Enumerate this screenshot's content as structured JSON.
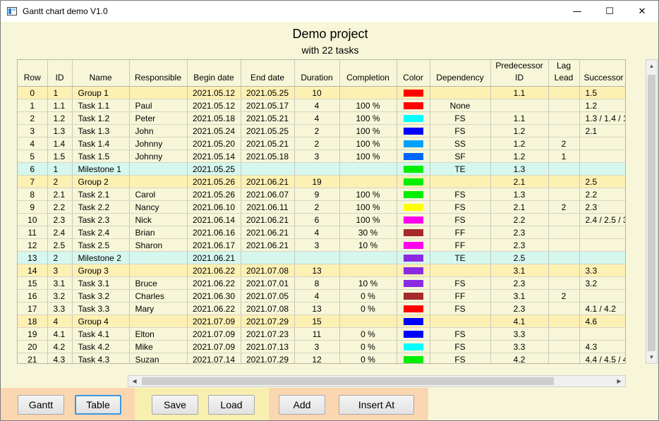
{
  "window": {
    "title": "Gantt chart demo V1.0",
    "minimize": "—",
    "maximize": "☐",
    "close": "✕"
  },
  "project": {
    "title": "Demo project",
    "subtitle": "with 22 tasks"
  },
  "columns": [
    "Row",
    "ID",
    "Name",
    "Responsible",
    "Begin date",
    "End date",
    "Duration",
    "Completion",
    "Color",
    "Dependency",
    "Predecessor ID",
    "Lag Lead",
    "Successor ID"
  ],
  "columns_wrapped": {
    "predecessor": [
      "Predecessor",
      "ID"
    ],
    "lag": [
      "Lag",
      "Lead"
    ],
    "successor": "Successor I"
  },
  "rows": [
    {
      "kind": "group",
      "row": "0",
      "id": "1",
      "name": "Group 1",
      "resp": "",
      "begin": "2021.05.12",
      "end": "2021.05.25",
      "dur": "10",
      "comp": "",
      "color": "#ff0000",
      "dep": "",
      "pred": "1.1",
      "lag": "",
      "succ": "1.5"
    },
    {
      "kind": "task",
      "row": "1",
      "id": "1.1",
      "name": "Task 1.1",
      "resp": "Paul",
      "begin": "2021.05.12",
      "end": "2021.05.17",
      "dur": "4",
      "comp": "100 %",
      "color": "#ff0000",
      "dep": "None",
      "pred": "",
      "lag": "",
      "succ": "1.2"
    },
    {
      "kind": "task",
      "row": "2",
      "id": "1.2",
      "name": "Task 1.2",
      "resp": "Peter",
      "begin": "2021.05.18",
      "end": "2021.05.21",
      "dur": "4",
      "comp": "100 %",
      "color": "#00ffff",
      "dep": "FS",
      "pred": "1.1",
      "lag": "",
      "succ": "1.3 / 1.4 / 1"
    },
    {
      "kind": "task",
      "row": "3",
      "id": "1.3",
      "name": "Task 1.3",
      "resp": "John",
      "begin": "2021.05.24",
      "end": "2021.05.25",
      "dur": "2",
      "comp": "100 %",
      "color": "#0000ff",
      "dep": "FS",
      "pred": "1.2",
      "lag": "",
      "succ": "2.1"
    },
    {
      "kind": "task",
      "row": "4",
      "id": "1.4",
      "name": "Task 1.4",
      "resp": "Johnny",
      "begin": "2021.05.20",
      "end": "2021.05.21",
      "dur": "2",
      "comp": "100 %",
      "color": "#00a0ff",
      "dep": "SS",
      "pred": "1.2",
      "lag": "2",
      "succ": ""
    },
    {
      "kind": "task",
      "row": "5",
      "id": "1.5",
      "name": "Task 1.5",
      "resp": "Johnny",
      "begin": "2021.05.14",
      "end": "2021.05.18",
      "dur": "3",
      "comp": "100 %",
      "color": "#0066ff",
      "dep": "SF",
      "pred": "1.2",
      "lag": "1",
      "succ": ""
    },
    {
      "kind": "milestone",
      "row": "6",
      "id": "1",
      "name": "Milestone 1",
      "resp": "",
      "begin": "2021.05.25",
      "end": "",
      "dur": "",
      "comp": "",
      "color": "#00ee00",
      "dep": "TE",
      "pred": "1.3",
      "lag": "",
      "succ": ""
    },
    {
      "kind": "group",
      "row": "7",
      "id": "2",
      "name": "Group 2",
      "resp": "",
      "begin": "2021.05.26",
      "end": "2021.06.21",
      "dur": "19",
      "comp": "",
      "color": "#00ee00",
      "dep": "",
      "pred": "2.1",
      "lag": "",
      "succ": "2.5"
    },
    {
      "kind": "task",
      "row": "8",
      "id": "2.1",
      "name": "Task 2.1",
      "resp": "Carol",
      "begin": "2021.05.26",
      "end": "2021.06.07",
      "dur": "9",
      "comp": "100 %",
      "color": "#00ee00",
      "dep": "FS",
      "pred": "1.3",
      "lag": "",
      "succ": "2.2"
    },
    {
      "kind": "task",
      "row": "9",
      "id": "2.2",
      "name": "Task 2.2",
      "resp": "Nancy",
      "begin": "2021.06.10",
      "end": "2021.06.11",
      "dur": "2",
      "comp": "100 %",
      "color": "#ffff00",
      "dep": "FS",
      "pred": "2.1",
      "lag": "2",
      "succ": "2.3"
    },
    {
      "kind": "task",
      "row": "10",
      "id": "2.3",
      "name": "Task 2.3",
      "resp": "Nick",
      "begin": "2021.06.14",
      "end": "2021.06.21",
      "dur": "6",
      "comp": "100 %",
      "color": "#ff00ee",
      "dep": "FS",
      "pred": "2.2",
      "lag": "",
      "succ": "2.4 / 2.5 / 3"
    },
    {
      "kind": "task",
      "row": "11",
      "id": "2.4",
      "name": "Task 2.4",
      "resp": "Brian",
      "begin": "2021.06.16",
      "end": "2021.06.21",
      "dur": "4",
      "comp": "30 %",
      "color": "#a52a2a",
      "dep": "FF",
      "pred": "2.3",
      "lag": "",
      "succ": ""
    },
    {
      "kind": "task",
      "row": "12",
      "id": "2.5",
      "name": "Task 2.5",
      "resp": "Sharon",
      "begin": "2021.06.17",
      "end": "2021.06.21",
      "dur": "3",
      "comp": "10 %",
      "color": "#ff00ee",
      "dep": "FF",
      "pred": "2.3",
      "lag": "",
      "succ": ""
    },
    {
      "kind": "milestone",
      "row": "13",
      "id": "2",
      "name": "Milestone 2",
      "resp": "",
      "begin": "2021.06.21",
      "end": "",
      "dur": "",
      "comp": "",
      "color": "#8a2be2",
      "dep": "TE",
      "pred": "2.5",
      "lag": "",
      "succ": ""
    },
    {
      "kind": "group",
      "row": "14",
      "id": "3",
      "name": "Group 3",
      "resp": "",
      "begin": "2021.06.22",
      "end": "2021.07.08",
      "dur": "13",
      "comp": "",
      "color": "#8a2be2",
      "dep": "",
      "pred": "3.1",
      "lag": "",
      "succ": "3.3"
    },
    {
      "kind": "task",
      "row": "15",
      "id": "3.1",
      "name": "Task 3.1",
      "resp": "Bruce",
      "begin": "2021.06.22",
      "end": "2021.07.01",
      "dur": "8",
      "comp": "10 %",
      "color": "#8a2be2",
      "dep": "FS",
      "pred": "2.3",
      "lag": "",
      "succ": "3.2"
    },
    {
      "kind": "task",
      "row": "16",
      "id": "3.2",
      "name": "Task 3.2",
      "resp": "Charles",
      "begin": "2021.06.30",
      "end": "2021.07.05",
      "dur": "4",
      "comp": "0 %",
      "color": "#a52a2a",
      "dep": "FF",
      "pred": "3.1",
      "lag": "2",
      "succ": ""
    },
    {
      "kind": "task",
      "row": "17",
      "id": "3.3",
      "name": "Task 3.3",
      "resp": "Mary",
      "begin": "2021.06.22",
      "end": "2021.07.08",
      "dur": "13",
      "comp": "0 %",
      "color": "#ff0000",
      "dep": "FS",
      "pred": "2.3",
      "lag": "",
      "succ": "4.1 / 4.2"
    },
    {
      "kind": "group",
      "row": "18",
      "id": "4",
      "name": "Group 4",
      "resp": "",
      "begin": "2021.07.09",
      "end": "2021.07.29",
      "dur": "15",
      "comp": "",
      "color": "#0000ff",
      "dep": "",
      "pred": "4.1",
      "lag": "",
      "succ": "4.6"
    },
    {
      "kind": "task",
      "row": "19",
      "id": "4.1",
      "name": "Task 4.1",
      "resp": "Elton",
      "begin": "2021.07.09",
      "end": "2021.07.23",
      "dur": "11",
      "comp": "0 %",
      "color": "#0000ff",
      "dep": "FS",
      "pred": "3.3",
      "lag": "",
      "succ": ""
    },
    {
      "kind": "task",
      "row": "20",
      "id": "4.2",
      "name": "Task 4.2",
      "resp": "Mike",
      "begin": "2021.07.09",
      "end": "2021.07.13",
      "dur": "3",
      "comp": "0 %",
      "color": "#00ffff",
      "dep": "FS",
      "pred": "3.3",
      "lag": "",
      "succ": "4.3"
    },
    {
      "kind": "task",
      "row": "21",
      "id": "4.3",
      "name": "Task 4.3",
      "resp": "Suzan",
      "begin": "2021.07.14",
      "end": "2021.07.29",
      "dur": "12",
      "comp": "0 %",
      "color": "#00ee00",
      "dep": "FS",
      "pred": "4.2",
      "lag": "",
      "succ": "4.4 / 4.5 / 4"
    }
  ],
  "toolbar": {
    "gantt": "Gantt",
    "table": "Table",
    "save": "Save",
    "load": "Load",
    "add": "Add",
    "insert": "Insert At"
  },
  "scroll": {
    "up": "▲",
    "down": "▼",
    "left": "◀",
    "right": "▶"
  },
  "colors": {
    "group_row": "#fdf0b3",
    "milestone_row": "#d5f7ee",
    "task_row": "#f7f6d8",
    "focus": "#3a98e0"
  }
}
